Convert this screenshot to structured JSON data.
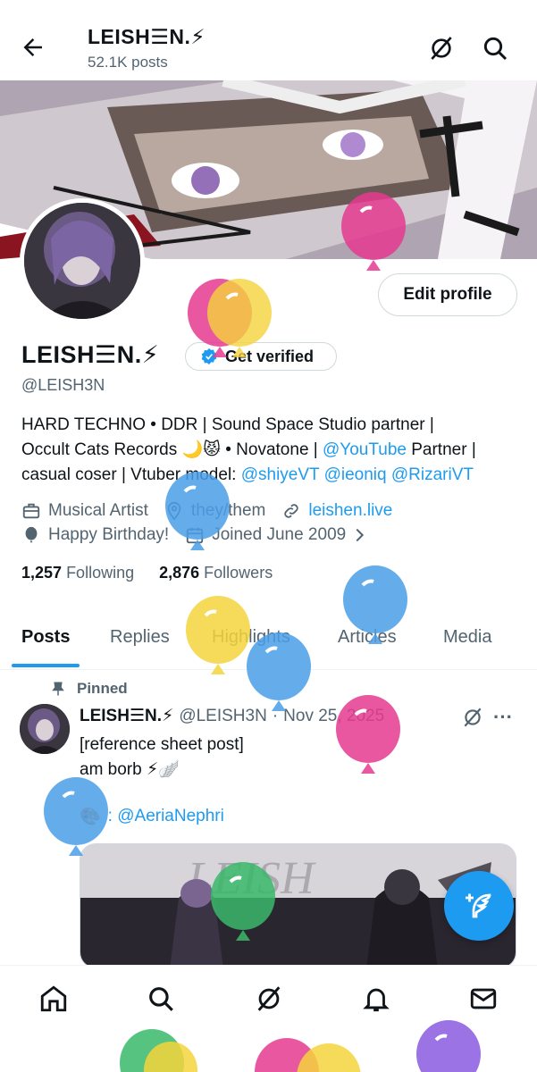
{
  "topbar": {
    "title": "LEISH・N.",
    "title_display": "LEISH☰N.⚡",
    "post_count": "52.1K posts",
    "icons": [
      "back-arrow-icon",
      "grok-icon",
      "search-icon"
    ]
  },
  "profile": {
    "display_name": "LEISH☰N.⚡",
    "handle": "@LEISH3N",
    "edit_profile_label": "Edit profile",
    "get_verified_label": "Get verified",
    "bio_parts": {
      "line1": "HARD TECHNO • DDR | Sound Space Studio partner |",
      "line2_a": "Occult Cats Records 🌙😾 • Novatone | ",
      "line2_link": "@YouTube",
      "line2_b": " Partner |",
      "line3_a": "casual coser | Vtuber model: ",
      "line3_link1": "@shiyeVT",
      "line3_link2": "@ieoniq",
      "line3_link3": "@RizariVT"
    },
    "category": "Musical Artist",
    "pronouns": "they/them",
    "website": "leishen.live",
    "birthday": "Happy Birthday!",
    "joined": "Joined June 2009",
    "following_count": "1,257",
    "following_label": "Following",
    "followers_count": "2,876",
    "followers_label": "Followers"
  },
  "tabs": [
    "Posts",
    "Replies",
    "Highlights",
    "Articles",
    "Media"
  ],
  "active_tab": "Posts",
  "pinned_post": {
    "pinned_label": "Pinned",
    "author_name": "LEISH☰N.⚡",
    "author_handle": "@LEISH3N",
    "separator": "·",
    "date": "Nov 25, 2025",
    "text_line1": "[reference sheet post]",
    "text_line2": "am borb ⚡🪽",
    "credit": ": @AeriaNephri"
  },
  "bottom_nav": [
    "home-icon",
    "search-icon",
    "grok-icon",
    "notifications-icon",
    "messages-icon"
  ],
  "colors": {
    "accent": "#1d9bf0",
    "text": "#0f1419",
    "muted": "#536471",
    "border": "#cfd9de"
  }
}
